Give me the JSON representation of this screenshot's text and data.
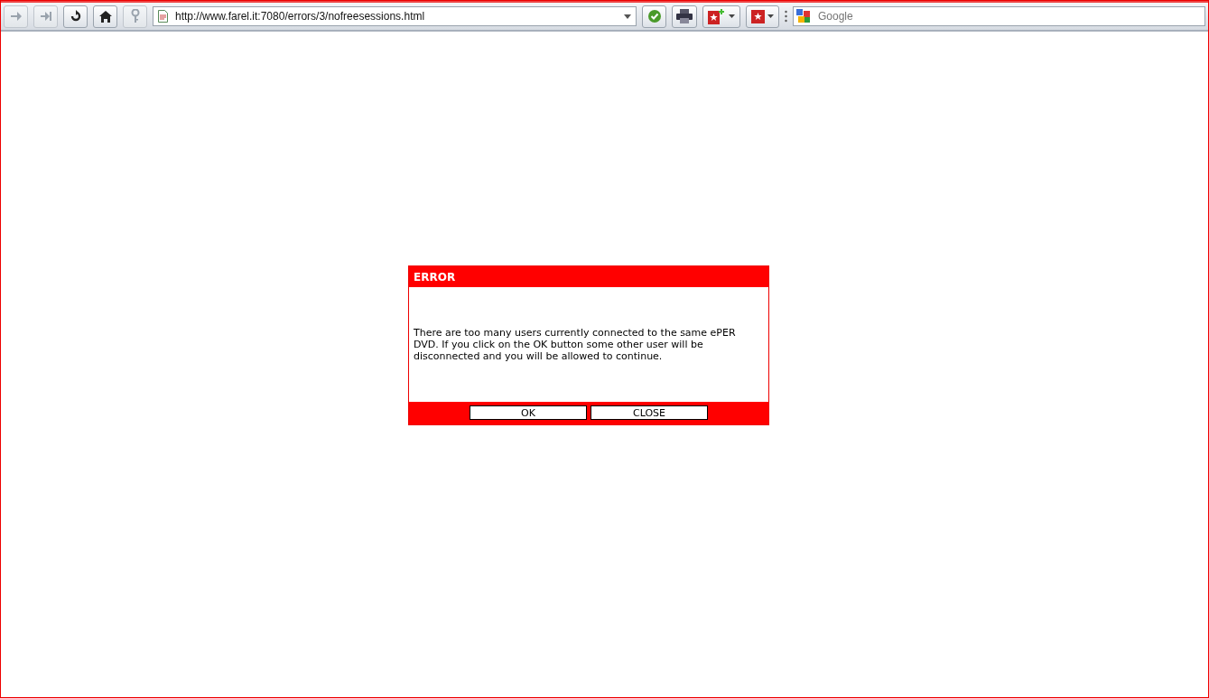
{
  "toolbar": {
    "nav_buttons": [
      {
        "kind": "forward",
        "disabled": true
      },
      {
        "kind": "skip",
        "disabled": true
      },
      {
        "kind": "reload",
        "disabled": false
      },
      {
        "kind": "home",
        "disabled": false
      },
      {
        "kind": "key",
        "disabled": true
      }
    ],
    "address": "http://www.farel.it:7080/errors/3/nofreesessions.html",
    "search": {
      "placeholder": "Google"
    }
  },
  "dialog": {
    "title": "ERROR",
    "message": "There are too many users currently connected to the same ePER DVD. If you click on the OK button some other user will be disconnected and you will be allowed to continue.",
    "buttons": [
      "OK",
      "CLOSE"
    ]
  }
}
